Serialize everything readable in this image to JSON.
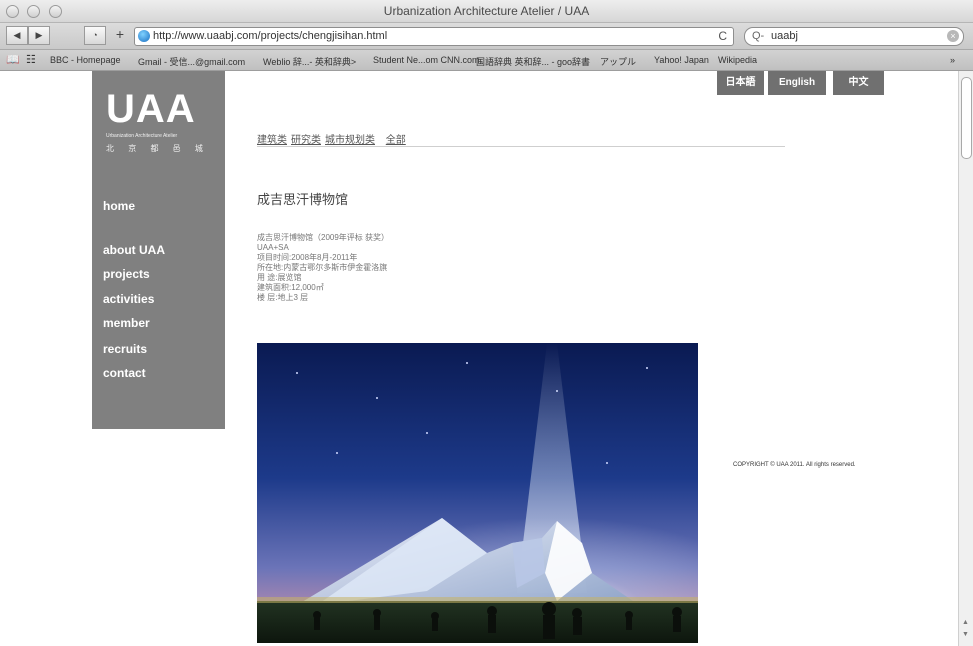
{
  "window": {
    "title": "Urbanization Architecture Atelier / UAA"
  },
  "toolbar": {
    "url": "http://www.uaabj.com/projects/chengjisihan.html",
    "reload_glyph": "C",
    "search_value": "uaabj",
    "search_icon": "Q-"
  },
  "bookmarks": [
    "BBC - Homepage",
    "Gmail - 受信...@gmail.com",
    "Weblio 辞...- 英和辞典>",
    "Student Ne...om CNN.com",
    "国語辞典 英和辞... - goo辞書",
    "アップル",
    "Yahoo! Japan",
    "Wikipedia"
  ],
  "site": {
    "logo": "UAA",
    "logo_sub": "Urbanization Architecture Atelier",
    "logo_cn": "北 京 都 邑 城",
    "nav": [
      "home",
      "about UAA",
      "projects",
      "activities",
      "member",
      "recruits",
      "contact"
    ],
    "lang": [
      "日本語",
      "English",
      "中文"
    ],
    "categories": [
      "建筑类",
      "研究类",
      "城市规划类",
      "全部"
    ],
    "project_title": "成吉思汗博物馆",
    "details": [
      "成吉思汗博物馆（2009年评标 获奖）",
      "UAA+SA",
      "项目时间:2008年8月-2011年",
      "所在地:内蒙古鄂尔多斯市伊金霍洛旗",
      "用 途:展览馆",
      "建筑面积:12,000㎡",
      "楼 层:地上3 层"
    ],
    "copyright": "COPYRIGHT © UAA 2011. All rights reserved."
  }
}
